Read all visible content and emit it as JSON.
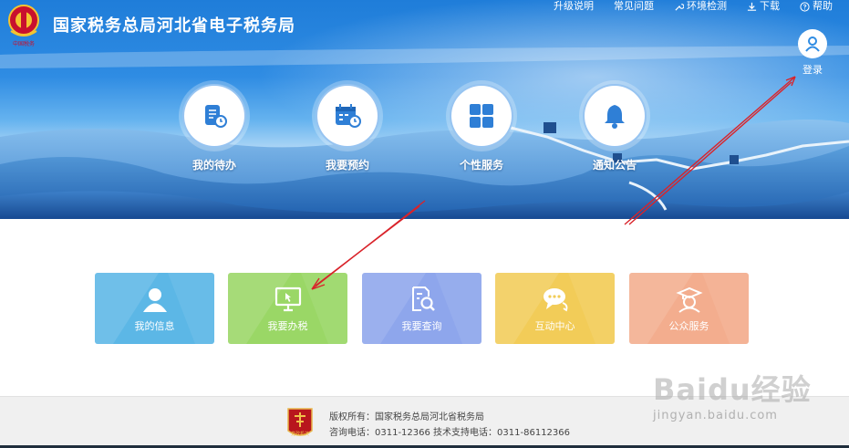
{
  "header": {
    "title": "国家税务总局河北省电子税务局",
    "logo_text": "中国税务",
    "links": [
      {
        "label": "升级说明",
        "icon": ""
      },
      {
        "label": "常见问题",
        "icon": ""
      },
      {
        "label": "环境检测",
        "icon": "wrench-icon"
      },
      {
        "label": "下载",
        "icon": "download-icon"
      },
      {
        "label": "帮助",
        "icon": "help-icon"
      }
    ],
    "login_label": "登录"
  },
  "features": [
    {
      "label": "我的待办",
      "icon": "todo-list-icon"
    },
    {
      "label": "我要预约",
      "icon": "calendar-clock-icon"
    },
    {
      "label": "个性服务",
      "icon": "grid-apps-icon"
    },
    {
      "label": "通知公告",
      "icon": "bell-icon"
    }
  ],
  "tiles": [
    {
      "label": "我的信息",
      "icon": "user-icon",
      "color": "#5cb7e6"
    },
    {
      "label": "我要办税",
      "icon": "monitor-icon",
      "color": "#9ad766"
    },
    {
      "label": "我要查询",
      "icon": "search-document-icon",
      "color": "#8ea6ec"
    },
    {
      "label": "互动中心",
      "icon": "chat-icon",
      "color": "#f2cc58"
    },
    {
      "label": "公众服务",
      "icon": "graduate-icon",
      "color": "#f3ad8e"
    }
  ],
  "footer": {
    "copyright": "版权所有：国家税务总局河北省税务局",
    "contact": "咨询电话：0311-12366  技术支持电话：0311-86112366",
    "badge_text": "党政机关"
  },
  "watermark": {
    "brand": "Baidu经验",
    "url": "jingyan.baidu.com"
  },
  "colors": {
    "hero_blue": "#2f8ce3",
    "annotation_red": "#d9232a"
  }
}
